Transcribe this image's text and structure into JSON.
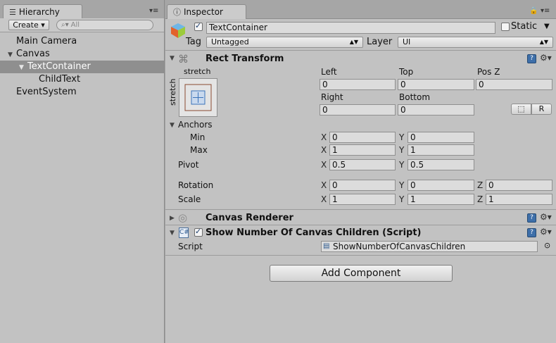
{
  "hierarchy": {
    "tab_label": "Hierarchy",
    "create_label": "Create",
    "search_placeholder": "All",
    "items": [
      {
        "label": "Main Camera",
        "depth": 0,
        "expanded": null,
        "selected": false
      },
      {
        "label": "Canvas",
        "depth": 0,
        "expanded": true,
        "selected": false
      },
      {
        "label": "TextContainer",
        "depth": 1,
        "expanded": true,
        "selected": true
      },
      {
        "label": "ChildText",
        "depth": 2,
        "expanded": null,
        "selected": false
      },
      {
        "label": "EventSystem",
        "depth": 0,
        "expanded": null,
        "selected": false
      }
    ]
  },
  "inspector": {
    "tab_label": "Inspector",
    "object_name": "TextContainer",
    "object_enabled": true,
    "static_label": "Static",
    "tag_label": "Tag",
    "tag_value": "Untagged",
    "layer_label": "Layer",
    "layer_value": "UI",
    "rect_transform": {
      "title": "Rect Transform",
      "anchor_preset_top": "stretch",
      "anchor_preset_side": "stretch",
      "left_label": "Left",
      "left_value": "0",
      "top_label": "Top",
      "top_value": "0",
      "posz_label": "Pos Z",
      "posz_value": "0",
      "right_label": "Right",
      "right_value": "0",
      "bottom_label": "Bottom",
      "bottom_value": "0",
      "raw_button_label": "R",
      "anchors_label": "Anchors",
      "min_label": "Min",
      "min_x": "0",
      "min_y": "0",
      "max_label": "Max",
      "max_x": "1",
      "max_y": "1",
      "pivot_label": "Pivot",
      "pivot_x": "0.5",
      "pivot_y": "0.5",
      "rotation_label": "Rotation",
      "rot_x": "0",
      "rot_y": "0",
      "rot_z": "0",
      "scale_label": "Scale",
      "scale_x": "1",
      "scale_y": "1",
      "scale_z": "1",
      "x": "X",
      "y": "Y",
      "z": "Z"
    },
    "canvas_renderer": {
      "title": "Canvas Renderer"
    },
    "script_component": {
      "title": "Show Number Of Canvas Children (Script)",
      "enabled": true,
      "script_label": "Script",
      "script_value": "ShowNumberOfCanvasChildren"
    },
    "add_component_label": "Add Component"
  },
  "icons": [
    "hierarchy-icon",
    "search-icon",
    "panel-menu-icon",
    "lock-icon",
    "gameobject-cube-icon",
    "rect-transform-icon",
    "canvas-renderer-icon",
    "script-icon",
    "help-book-icon",
    "gear-icon",
    "object-picker-icon"
  ]
}
